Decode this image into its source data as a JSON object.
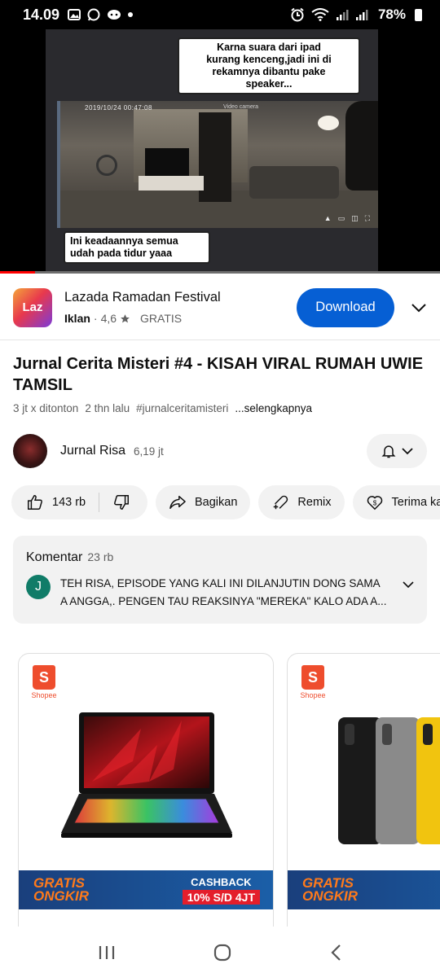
{
  "status_bar": {
    "time": "14.09",
    "battery": "78%"
  },
  "video": {
    "caption_top": "Karna suara dari ipad\nkurang kenceng,jadi ini di\nrekamnya dibantu pake\nspeaker...",
    "caption_bottom": "Ini keadaannya semua\nudah pada tidur yaaa",
    "cctv_timestamp": "2019/10/24  00:47:08",
    "cctv_camera_label": "Video camera",
    "progress": 0.08
  },
  "ad": {
    "logo_text": "Laz",
    "title": "Lazada Ramadan Festival",
    "badge": "Iklan",
    "separator": "·",
    "rating": "4,6",
    "price": "GRATIS",
    "button": "Download"
  },
  "video_info": {
    "title": "Jurnal Cerita Misteri #4 - KISAH VIRAL RUMAH UWIE TAMSIL",
    "views": "3 jt x ditonton",
    "age": "2 thn lalu",
    "hashtag": "#jurnalceritamisteri",
    "more": "...selengkapnya"
  },
  "channel": {
    "name": "Jurnal Risa",
    "subscribers": "6,19 jt"
  },
  "actions": {
    "likes": "143 rb",
    "share": "Bagikan",
    "remix": "Remix",
    "thanks": "Terima ka"
  },
  "comments": {
    "label": "Komentar",
    "count": "23 rb",
    "avatar_letter": "J",
    "line1": "TEH RISA, EPISODE YANG KALI INI DILANJUTIN DONG SAMA",
    "line2": "A ANGGA,. PENGEN TAU REAKSINYA \"MEREKA\" KALO ADA A..."
  },
  "products": [
    {
      "store": "Shopee",
      "store_glyph": "S",
      "banner_left": "GRATIS\nONGKIR",
      "banner_right_title": "CASHBACK",
      "banner_right_value": "10% S/D 4JT"
    },
    {
      "store": "Shopee",
      "store_glyph": "S",
      "banner_left": "GRATIS\nONGKIR"
    }
  ],
  "colors": {
    "download": "#065fd4",
    "progress": "#ff0000",
    "shopee": "#ee4d2d",
    "comment_avatar": "#107c68"
  }
}
